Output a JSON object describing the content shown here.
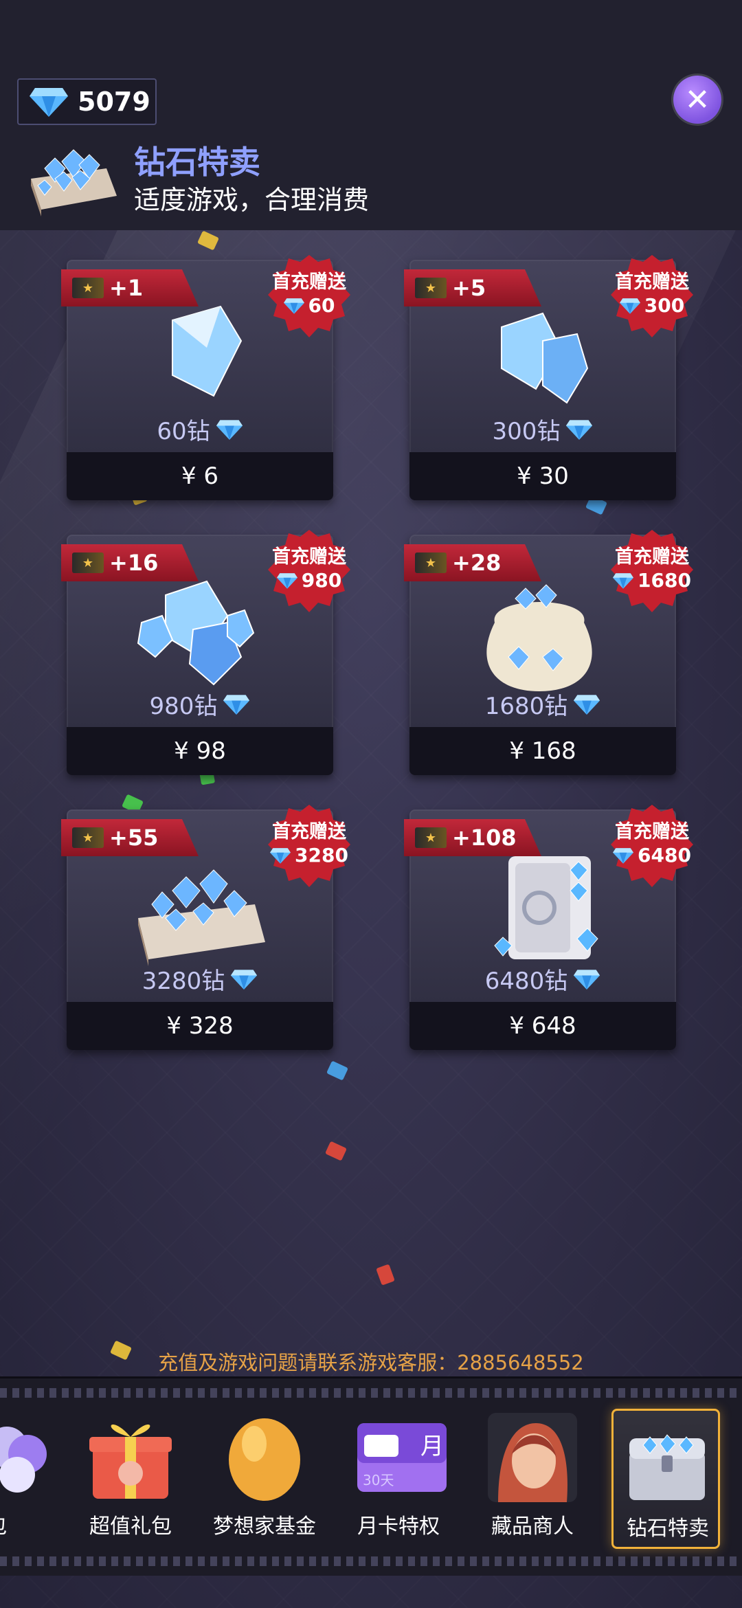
{
  "header": {
    "balance": "5079",
    "title": "钻石特卖",
    "subtitle": "适度游戏，合理消费",
    "close_icon": "close-icon"
  },
  "packs": [
    {
      "bonus": "+1",
      "badge_text": "首充赠送",
      "badge_amount": "60",
      "amount_label": "60钻",
      "price": "¥ 6"
    },
    {
      "bonus": "+5",
      "badge_text": "首充赠送",
      "badge_amount": "300",
      "amount_label": "300钻",
      "price": "¥ 30"
    },
    {
      "bonus": "+16",
      "badge_text": "首充赠送",
      "badge_amount": "980",
      "amount_label": "980钻",
      "price": "¥ 98"
    },
    {
      "bonus": "+28",
      "badge_text": "首充赠送",
      "badge_amount": "1680",
      "amount_label": "1680钻",
      "price": "¥ 168"
    },
    {
      "bonus": "+55",
      "badge_text": "首充赠送",
      "badge_amount": "3280",
      "amount_label": "3280钻",
      "price": "¥ 328"
    },
    {
      "bonus": "+108",
      "badge_text": "首充赠送",
      "badge_amount": "6480",
      "amount_label": "6480钻",
      "price": "¥ 648"
    }
  ],
  "support_text": "充值及游戏问题请联系游戏客服：2885648552",
  "tabs": [
    {
      "label": "礼包",
      "icon": "balloon-icon"
    },
    {
      "label": "超值礼包",
      "icon": "gift-box-icon"
    },
    {
      "label": "梦想家基金",
      "icon": "golden-egg-icon"
    },
    {
      "label": "月卡特权",
      "icon": "month-card-icon",
      "card_text": "月",
      "card_days": "30天"
    },
    {
      "label": "藏品商人",
      "icon": "merchant-avatar-icon"
    },
    {
      "label": "钻石特卖",
      "icon": "diamond-chest-icon",
      "active": true
    }
  ],
  "colors": {
    "accent": "#8fa0ff",
    "ribbon": "#c2283a",
    "support": "#e6a247",
    "active_tab_border": "#f2b23a"
  }
}
